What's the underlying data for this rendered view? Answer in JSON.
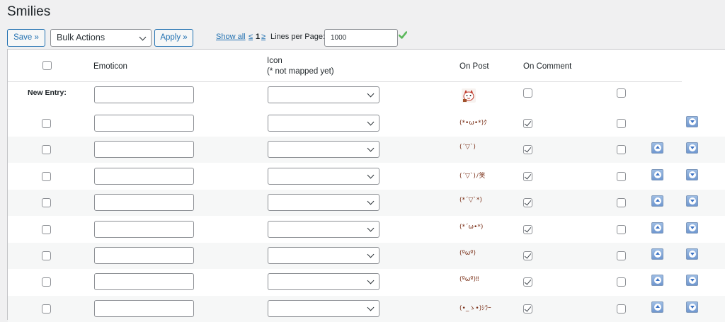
{
  "page": {
    "title": "Smilies"
  },
  "toolbar": {
    "save_label": "Save »",
    "bulk_actions": "Bulk Actions",
    "apply_label": "Apply »",
    "show_all": "Show all",
    "prev": "≤",
    "page_number": "1",
    "next": "≥",
    "lines_per_page_label": "Lines per Page:",
    "lines_per_page_value": "1000"
  },
  "columns": {
    "emoticon": "Emoticon",
    "icon": "Icon",
    "icon_note": "(* not mapped yet)",
    "on_post": "On Post",
    "on_comment": "On Comment"
  },
  "new_entry": {
    "label": "New Entry:",
    "on_post": false,
    "on_comment": false
  },
  "rows": [
    {
      "emoticon": "",
      "icon": "(*•ω•*)ｸ",
      "on_post": true,
      "on_comment": false,
      "move_up": false,
      "move_down": true
    },
    {
      "emoticon": "",
      "icon": "(´▽`)",
      "on_post": true,
      "on_comment": false,
      "move_up": true,
      "move_down": true
    },
    {
      "emoticon": "",
      "icon": "(´▽`)ﾉ笑",
      "on_post": true,
      "on_comment": false,
      "move_up": true,
      "move_down": true
    },
    {
      "emoticon": "",
      "icon": "(*´▽`*)",
      "on_post": true,
      "on_comment": false,
      "move_up": true,
      "move_down": true
    },
    {
      "emoticon": "",
      "icon": "(*´ω•*)",
      "on_post": true,
      "on_comment": false,
      "move_up": true,
      "move_down": true
    },
    {
      "emoticon": "",
      "icon": "(ºωº)",
      "on_post": true,
      "on_comment": false,
      "move_up": true,
      "move_down": true
    },
    {
      "emoticon": "",
      "icon": "(ºωº)‼",
      "on_post": true,
      "on_comment": false,
      "move_up": true,
      "move_down": true
    },
    {
      "emoticon": "",
      "icon": "(•_ゝ•)ｼﾗｰ",
      "on_post": true,
      "on_comment": false,
      "move_up": true,
      "move_down": true
    }
  ],
  "colors": {
    "accent": "#2271b1",
    "background": "#f0f0f1",
    "confirm_check": "#5cb85c"
  },
  "icons": {
    "confirm": "checkmark-icon",
    "up": "move-up-icon",
    "down": "move-down-icon",
    "dropdown": "chevron-down-icon"
  }
}
